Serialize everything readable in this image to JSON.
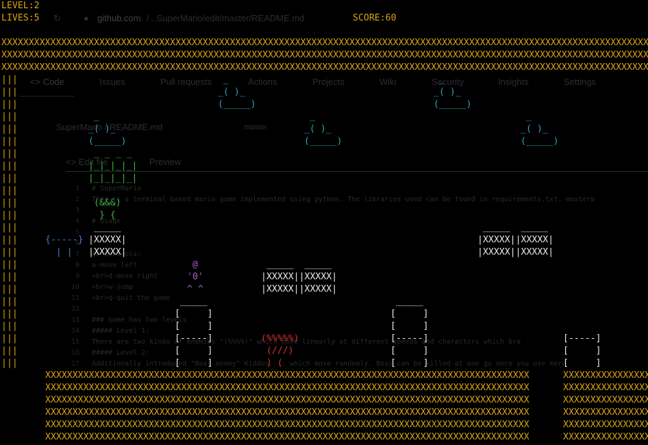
{
  "hud": {
    "level": "LEVEL:2",
    "lives": "LIVES:5",
    "score": "SCORE:60"
  },
  "background": {
    "url_domain": "github.com",
    "url_path": "/...SuperMario/edit/master/README.md",
    "tabs": [
      "<> Code",
      "Issues",
      "Pull requests",
      "Actions",
      "Projects",
      "Wiki",
      "Security",
      "Insights",
      "Settings"
    ],
    "breadcrumb": "SuperMario / README.md",
    "branch": "master",
    "edit_tabs": [
      "<> Edit file",
      "Preview"
    ],
    "code_lines": [
      "# SuperMario",
      "This is a terminal based mario game implemented using python. The libraries used can be found in requirements.txt. masterb",
      "",
      "# Usage",
      "",
      "",
      "## Controls:",
      "a-move left",
      "<br>d-move right",
      "<br>w-jump",
      "<br>q-quit the game",
      "",
      "### Game has two levels",
      "##### Level 1:",
      "There are two kinds of enemies \"(%%%%)\" which move linearly at different speeds and characters which bra",
      "##### Level 2:",
      "Additionally introduced \"Boss enemy\" Kiddos ... which move randomly. Boss can be killed at one go once you use more"
    ]
  },
  "game": {
    "wall_rows": [
      "XXXXXXXXXXXXXXXXXXXXXXXXXXXXXXXXXXXXXXXXXXXXXXXXXXXXXXXXXXXXXXXXXXXXXXXXXXXXXXXXXXXXXXXXXXXXXXXXXXXXXXXXXXXXXXXXXXXXXXXX",
      "XXXXXXXXXXXXXXXXXXXXXXXXXXXXXXXXXXXXXXXXXXXXXXXXXXXXXXXXXXXXXXXXXXXXXXXXXXXXXXXXXXXXXXXXXXXXXXXXXXXXXXXXXXXXXXXXXXXXXXXX",
      "XXXXXXXXXXXXXXXXXXXXXXXXXXXXXXXXXXXXXXXXXXXXXXXXXXXXXXXXXXXXXXXXXXXXXXXXXXXXXXXXXXXXXXXXXXXXXXXXXXXXXXXXXXXXXXXXXXXXXXXX"
    ],
    "left_wall": "|||\n|||\n|||\n|||\n|||\n|||\n|||\n|||\n|||\n|||\n|||\n|||\n|||\n|||\n|||\n|||\n|||\n|||\n|||\n|||\n|||\n|||\n|||\n|||",
    "cloud": " _\n_( )_\n(_____)",
    "ground_left": "XXXXXXXXXXXXXXXXXXXXXXXXXXXXXXXXXXXXXXXXXXXXXXXXXXXXXXXXXXXXXXXXXXXXXXXXXXXXXXXXXXXXXXXXX\nXXXXXXXXXXXXXXXXXXXXXXXXXXXXXXXXXXXXXXXXXXXXXXXXXXXXXXXXXXXXXXXXXXXXXXXXXXXXXXXXXXXXXXXXX\nXXXXXXXXXXXXXXXXXXXXXXXXXXXXXXXXXXXXXXXXXXXXXXXXXXXXXXXXXXXXXXXXXXXXXXXXXXXXXXXXXXXXXXXXX\nXXXXXXXXXXXXXXXXXXXXXXXXXXXXXXXXXXXXXXXXXXXXXXXXXXXXXXXXXXXXXXXXXXXXXXXXXXXXXXXXXXXXXXXXX\nXXXXXXXXXXXXXXXXXXXXXXXXXXXXXXXXXXXXXXXXXXXXXXXXXXXXXXXXXXXXXXXXXXXXXXXXXXXXXXXXXXXXXXXXX\nXXXXXXXXXXXXXXXXXXXXXXXXXXXXXXXXXXXXXXXXXXXXXXXXXXXXXXXXXXXXXXXXXXXXXXXXXXXXXXXXXXXXXXXXX",
    "ground_right": "XXXXXXXXXXXXXXXXXX\nXXXXXXXXXXXXXXXXXX\nXXXXXXXXXXXXXXXXXX\nXXXXXXXXXXXXXXXXXX\nXXXXXXXXXXXXXXXXXX\nXXXXXXXXXXXXXXXXXX",
    "castle": " _ _ _ _\n|_|_|_|_|\n|_|_|_|_|",
    "boss": "(&&&)\n } {",
    "spring": "{-----}\n  | |",
    "brick_single": " _____\n|XXXXX|\n|XXXXX|",
    "brick_double": " _____  _____\n|XXXXX||XXXXX|\n|XXXXX||XXXXX|",
    "mario": " @\n'0'\n^ ^",
    "enemy": "(%%%%%)\n (///)\n ) (",
    "pipe_tall": " _____\n[     ]\n[     ]\n[-----]\n[     ]\n[     ]",
    "pipe_short": "[-----]\n[     ]\n[     ]"
  }
}
